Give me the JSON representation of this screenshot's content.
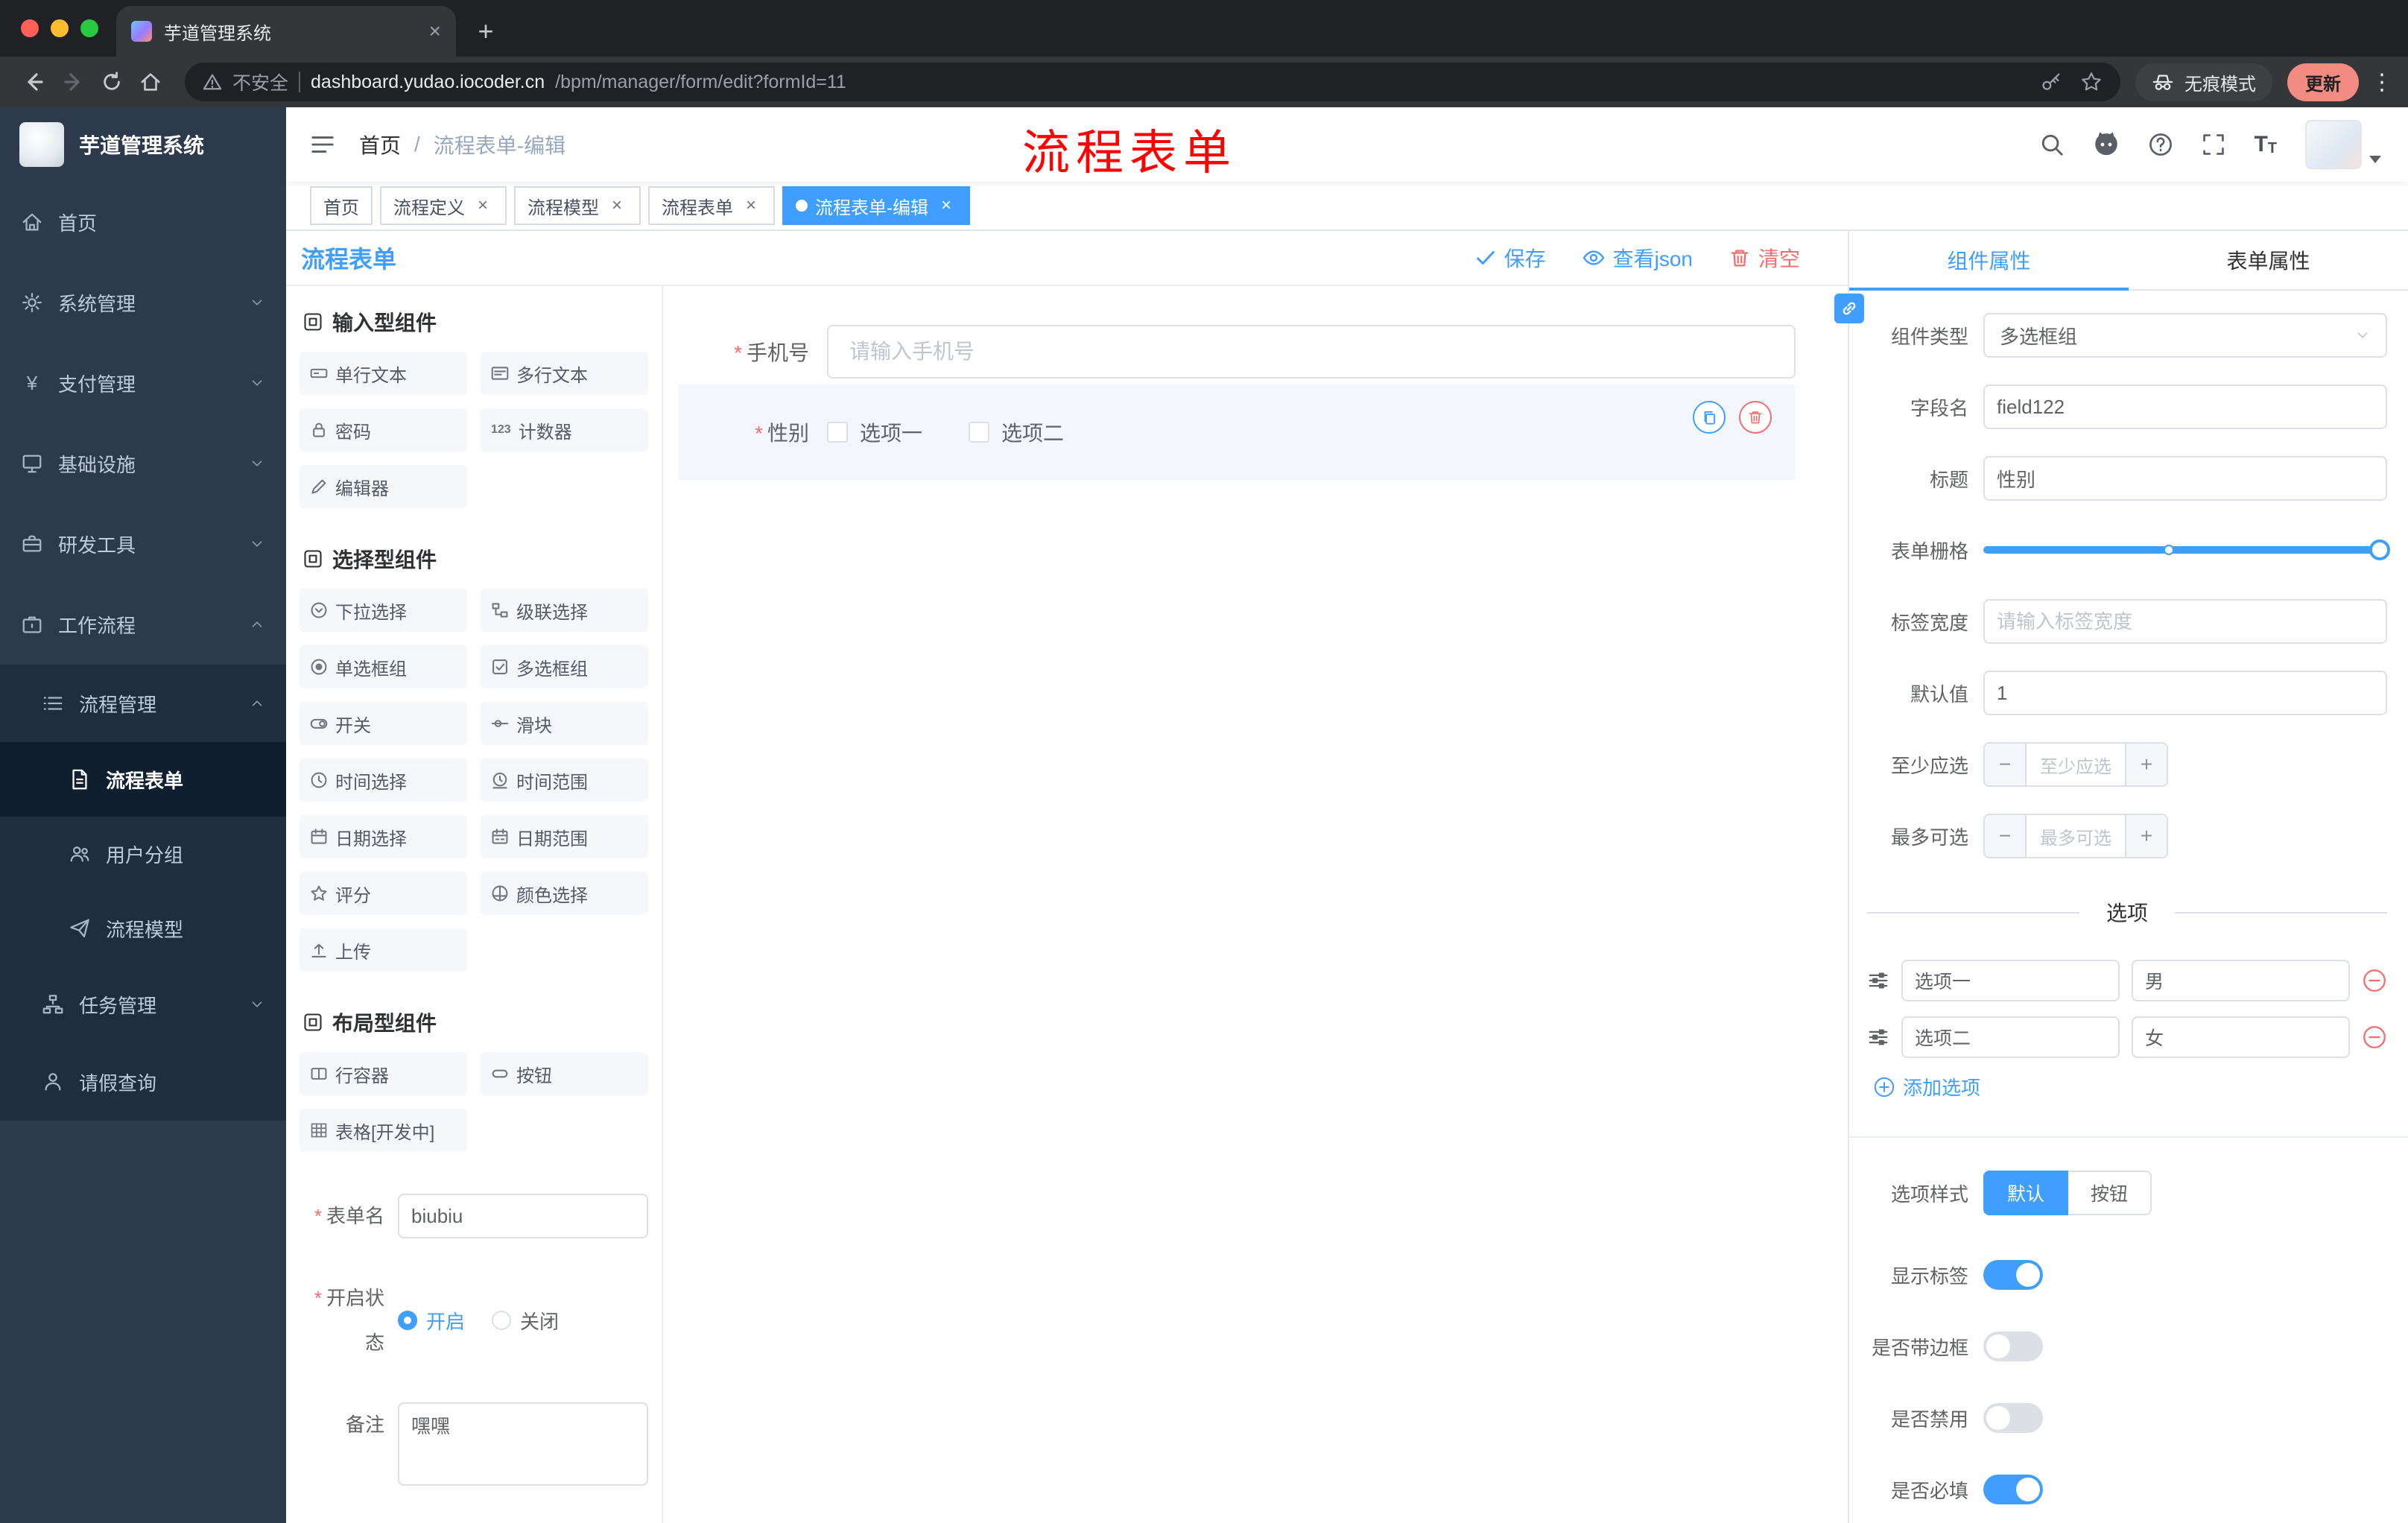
{
  "browser": {
    "tab_title": "芋道管理系统",
    "security_label": "不安全",
    "url_host": "dashboard.yudao.iocoder.cn",
    "url_path": "/bpm/manager/form/edit?formId=11",
    "incognito_label": "无痕模式",
    "update_label": "更新"
  },
  "sidebar": {
    "logo_title": "芋道管理系统",
    "items": [
      {
        "label": "首页"
      },
      {
        "label": "系统管理"
      },
      {
        "label": "支付管理"
      },
      {
        "label": "基础设施"
      },
      {
        "label": "研发工具"
      },
      {
        "label": "工作流程"
      },
      {
        "label": "流程管理"
      },
      {
        "label": "流程表单"
      },
      {
        "label": "用户分组"
      },
      {
        "label": "流程模型"
      },
      {
        "label": "任务管理"
      },
      {
        "label": "请假查询"
      }
    ]
  },
  "header": {
    "breadcrumb_home": "首页",
    "breadcrumb_current": "流程表单-编辑",
    "annotation": "流程表单"
  },
  "tags": [
    {
      "label": "首页"
    },
    {
      "label": "流程定义"
    },
    {
      "label": "流程模型"
    },
    {
      "label": "流程表单"
    },
    {
      "label": "流程表单-编辑"
    }
  ],
  "designer": {
    "title": "流程表单",
    "save_label": "保存",
    "view_json_label": "查看json",
    "clear_label": "清空",
    "palette": {
      "section_input": "输入型组件",
      "section_select": "选择型组件",
      "section_layout": "布局型组件",
      "input_items": [
        "单行文本",
        "多行文本",
        "密码",
        "计数器",
        "编辑器"
      ],
      "select_items": [
        "下拉选择",
        "级联选择",
        "单选框组",
        "多选框组",
        "开关",
        "滑块",
        "时间选择",
        "时间范围",
        "日期选择",
        "日期范围",
        "评分",
        "颜色选择",
        "上传"
      ],
      "layout_items": [
        "行容器",
        "按钮",
        "表格[开发中]"
      ]
    },
    "meta_form": {
      "name_label": "表单名",
      "name_value": "biubiu",
      "status_label": "开启状态",
      "status_on": "开启",
      "status_off": "关闭",
      "remark_label": "备注",
      "remark_value": "嘿嘿"
    },
    "canvas": {
      "phone_label": "手机号",
      "phone_placeholder": "请输入手机号",
      "gender_label": "性别",
      "gender_option1": "选项一",
      "gender_option2": "选项二"
    },
    "props": {
      "tab_component": "组件属性",
      "tab_form": "表单属性",
      "component_type_label": "组件类型",
      "component_type_value": "多选框组",
      "field_name_label": "字段名",
      "field_name_value": "field122",
      "title_label": "标题",
      "title_value": "性别",
      "grid_label": "表单栅格",
      "label_width_label": "标签宽度",
      "label_width_placeholder": "请输入标签宽度",
      "default_label": "默认值",
      "default_value": "1",
      "min_label": "至少应选",
      "min_placeholder": "至少应选",
      "max_label": "最多可选",
      "max_placeholder": "最多可选",
      "options_divider": "选项",
      "option1_label": "选项一",
      "option1_value": "男",
      "option2_label": "选项二",
      "option2_value": "女",
      "add_option": "添加选项",
      "style_label": "选项样式",
      "style_default": "默认",
      "style_button": "按钮",
      "toggle_show_label": "显示标签",
      "toggle_border": "是否带边框",
      "toggle_disabled": "是否禁用",
      "toggle_required": "是否必填"
    }
  },
  "colors": {
    "accent": "#409EFF",
    "danger": "#F56C6C",
    "annotation_red": "#FE0100",
    "sidebar_bg": "#2D3A4B"
  }
}
